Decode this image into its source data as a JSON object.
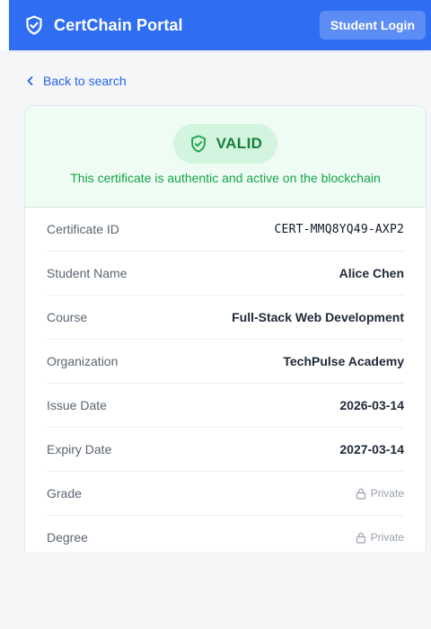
{
  "header": {
    "brand_icon": "shield-check-icon",
    "title": "CertChain Portal",
    "login_label": "Student Login",
    "accent": "#2f6ef3"
  },
  "nav": {
    "back_label": "Back to search",
    "back_icon": "chevron-left-icon"
  },
  "status": {
    "badge": "VALID",
    "badge_icon": "shield-check-icon",
    "message": "This certificate is authentic and active on the blockchain",
    "color": "#15803d"
  },
  "details": [
    {
      "label": "Certificate ID",
      "value": "CERT-MMQ8YQ49-AXP2"
    },
    {
      "label": "Student Name",
      "value": "Alice Chen"
    },
    {
      "label": "Course",
      "value": "Full-Stack Web Development"
    },
    {
      "label": "Organization",
      "value": "TechPulse Academy"
    },
    {
      "label": "Issue Date",
      "value": "2026-03-14"
    },
    {
      "label": "Expiry Date",
      "value": "2027-03-14"
    },
    {
      "label": "Grade",
      "value": "Private",
      "icon": "lock-icon"
    },
    {
      "label": "Degree",
      "value": "Private",
      "icon": "lock-icon"
    }
  ]
}
